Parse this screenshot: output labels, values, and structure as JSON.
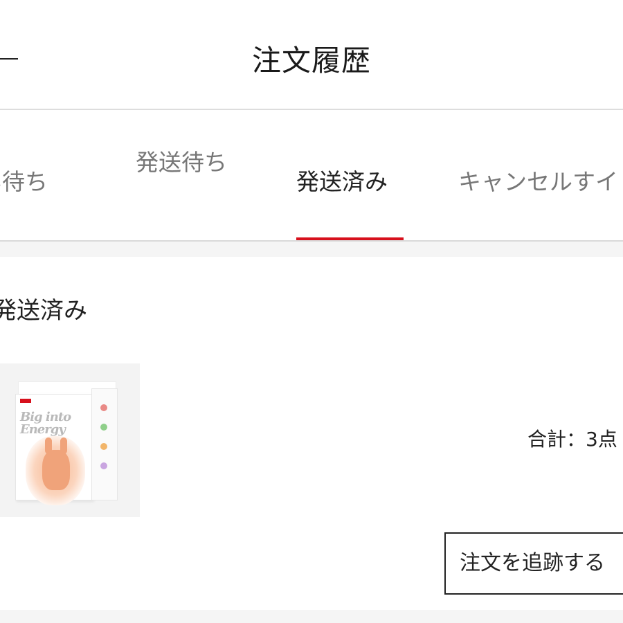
{
  "header": {
    "title": "注文履歴",
    "back_icon": "back-arrow-icon"
  },
  "tabs": [
    {
      "label": "い待ち",
      "active": false
    },
    {
      "label": "発送待ち",
      "active": false
    },
    {
      "label": "発送済み",
      "active": true
    },
    {
      "label": "キャンセルすイ",
      "active": false
    }
  ],
  "colors": {
    "accent": "#d7101c",
    "text": "#222222",
    "muted": "#777777"
  },
  "order": {
    "status": "発送済み",
    "product_image": {
      "box_text": "Big into Energy"
    },
    "total": "合計：3点",
    "track_button_label": "注文を追跡する"
  }
}
